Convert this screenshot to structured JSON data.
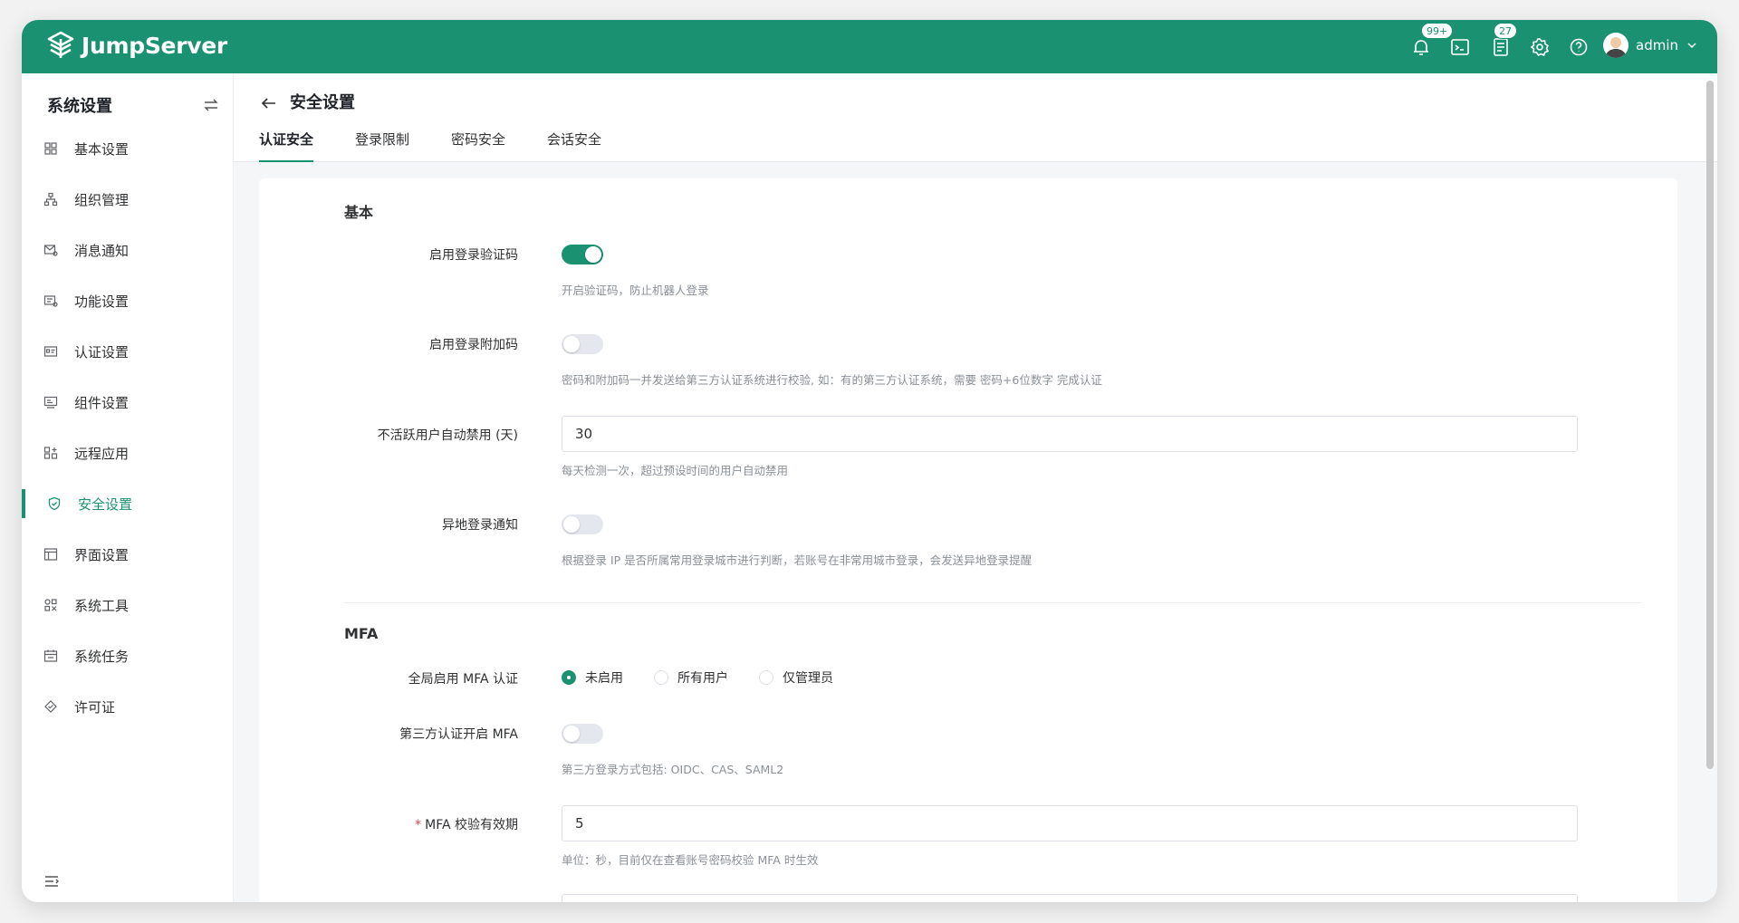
{
  "topbar": {
    "logo_text": "JumpServer",
    "notification_badge": "99+",
    "tickets_badge": "27",
    "username": "admin",
    "accent": "#1a9272"
  },
  "sidebar": {
    "title": "系统设置",
    "items": [
      {
        "label": "基本设置",
        "icon": "grid-icon"
      },
      {
        "label": "组织管理",
        "icon": "org-tree-icon"
      },
      {
        "label": "消息通知",
        "icon": "message-icon"
      },
      {
        "label": "功能设置",
        "icon": "feature-icon"
      },
      {
        "label": "认证设置",
        "icon": "id-card-icon"
      },
      {
        "label": "组件设置",
        "icon": "component-icon"
      },
      {
        "label": "远程应用",
        "icon": "remote-app-icon"
      },
      {
        "label": "安全设置",
        "icon": "shield-icon",
        "active": true
      },
      {
        "label": "界面设置",
        "icon": "layout-icon"
      },
      {
        "label": "系统工具",
        "icon": "tools-icon"
      },
      {
        "label": "系统任务",
        "icon": "calendar-icon"
      },
      {
        "label": "许可证",
        "icon": "license-icon"
      }
    ]
  },
  "page": {
    "title": "安全设置",
    "tabs": [
      "认证安全",
      "登录限制",
      "密码安全",
      "会话安全"
    ],
    "active_tab": "认证安全"
  },
  "form": {
    "basic_title": "基本",
    "captcha_label": "启用登录验证码",
    "captcha_hint": "开启验证码，防止机器人登录",
    "captcha_on": true,
    "addcode_label": "启用登录附加码",
    "addcode_hint": "密码和附加码一并发送给第三方认证系统进行校验, 如：有的第三方认证系统，需要 密码+6位数字 完成认证",
    "addcode_on": false,
    "inactive_label": "不活跃用户自动禁用 (天)",
    "inactive_value": "30",
    "inactive_hint": "每天检测一次，超过预设时间的用户自动禁用",
    "remote_label": "异地登录通知",
    "remote_hint": "根据登录 IP 是否所属常用登录城市进行判断，若账号在非常用城市登录，会发送异地登录提醒",
    "remote_on": false,
    "mfa_title": "MFA",
    "global_mfa_label": "全局启用 MFA 认证",
    "global_mfa_options": [
      "未启用",
      "所有用户",
      "仅管理员"
    ],
    "global_mfa_selected": "未启用",
    "third_mfa_label": "第三方认证开启 MFA",
    "third_mfa_hint": "第三方登录方式包括: OIDC、CAS、SAML2",
    "third_mfa_on": false,
    "mfa_ttl_label": "MFA 校验有效期",
    "mfa_ttl_required": "*",
    "mfa_ttl_value": "5",
    "mfa_ttl_hint": "单位：秒，目前仅在查看账号密码校验 MFA 时生效"
  }
}
